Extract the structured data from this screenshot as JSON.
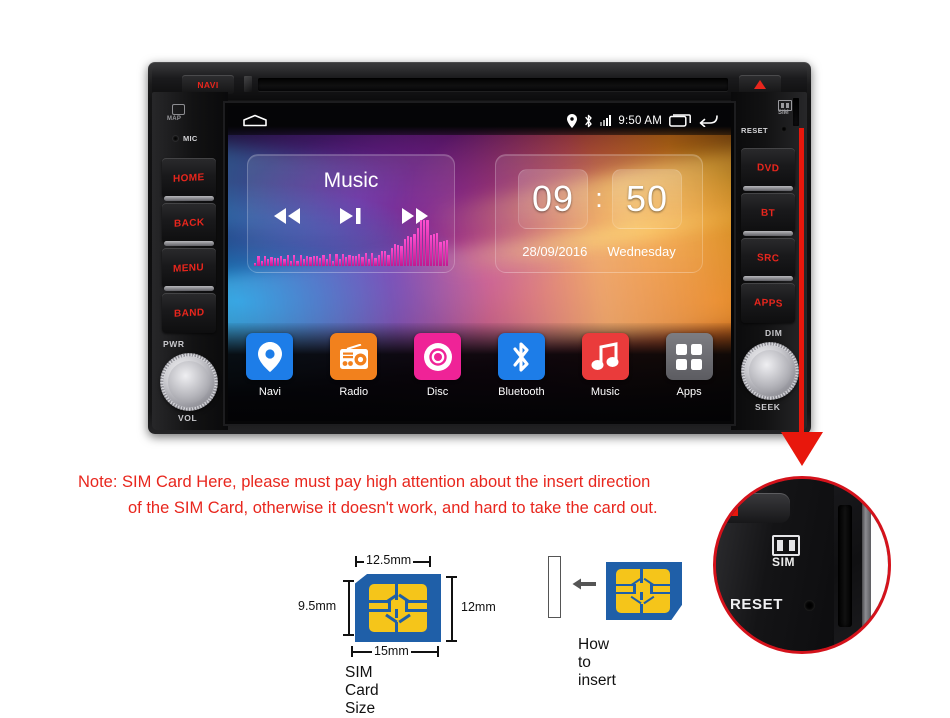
{
  "head_unit": {
    "top_bezel": {
      "navi_label": "NAVI",
      "eject_icon": "eject-triangle-icon",
      "disc_slot": "disc-slot"
    },
    "left_panel": {
      "map_icon": "map-icon",
      "map_label": "MAP",
      "mic_label": "MIC",
      "buttons": [
        {
          "label": "HOME"
        },
        {
          "label": "BACK"
        },
        {
          "label": "MENU"
        },
        {
          "label": "BAND"
        }
      ],
      "knob": {
        "top_label": "PWR",
        "bottom_label": "VOL"
      }
    },
    "right_panel": {
      "sim_icon": "sim-card-icon",
      "sim_label": "SIM",
      "reset_label": "RESET",
      "buttons": [
        {
          "label": "DVD"
        },
        {
          "label": "BT"
        },
        {
          "label": "SRC"
        },
        {
          "label": "APPS"
        }
      ],
      "knob": {
        "top_label": "DIM",
        "bottom_label": "SEEK"
      }
    },
    "screen": {
      "status_bar": {
        "home_icon": "home-icon",
        "gps_icon": "location-pin-icon",
        "bluetooth_icon": "bluetooth-icon",
        "signal_icon": "signal-bars-icon",
        "time": "9:50 AM",
        "recents_icon": "recents-icon",
        "back_icon": "back-arrow-icon"
      },
      "music_widget": {
        "title": "Music",
        "prev_icon": "previous-track-icon",
        "play_icon": "play-pause-icon",
        "next_icon": "next-track-icon",
        "equalizer": "audio-equalizer"
      },
      "clock_widget": {
        "hours": "09",
        "separator": ":",
        "minutes": "50",
        "date": "28/09/2016",
        "weekday": "Wednesday"
      },
      "apps": [
        {
          "label": "Navi",
          "icon": "location-pin-icon",
          "color": "#1d7de8"
        },
        {
          "label": "Radio",
          "icon": "radio-icon",
          "color": "#f2811d"
        },
        {
          "label": "Disc",
          "icon": "disc-icon",
          "color": "#ef2397"
        },
        {
          "label": "Bluetooth",
          "icon": "bluetooth-icon",
          "color": "#1d7de8"
        },
        {
          "label": "Music",
          "icon": "music-note-icon",
          "color": "#ea3b3b"
        },
        {
          "label": "Apps",
          "icon": "app-grid-icon",
          "color": "#6f6f74"
        }
      ]
    }
  },
  "note": {
    "line1": "Note: SIM Card Here, please must pay high attention about the insert direction",
    "line2": "of the SIM Card, otherwise it doesn't work, and hard to take the card out.",
    "color": "#e8261d"
  },
  "arrow": {
    "name": "red-down-arrow",
    "color": "#e8170c"
  },
  "sim_diagram": {
    "caption": "SIM Card Size",
    "dim_top": "12.5mm",
    "dim_bottom": "15mm",
    "dim_right": "12mm",
    "dim_left": "9.5mm",
    "card_color": "#1f5fa8",
    "chip_color": "#f5c51a"
  },
  "insert_diagram": {
    "caption": "How to insert",
    "arrow_icon": "left-arrow-icon",
    "slot_icon": "sim-slot-outline"
  },
  "callout": {
    "sim_label": "SIM",
    "reset_label": "RESET",
    "sim_icon": "sim-card-icon",
    "border_color": "#d4121b"
  }
}
